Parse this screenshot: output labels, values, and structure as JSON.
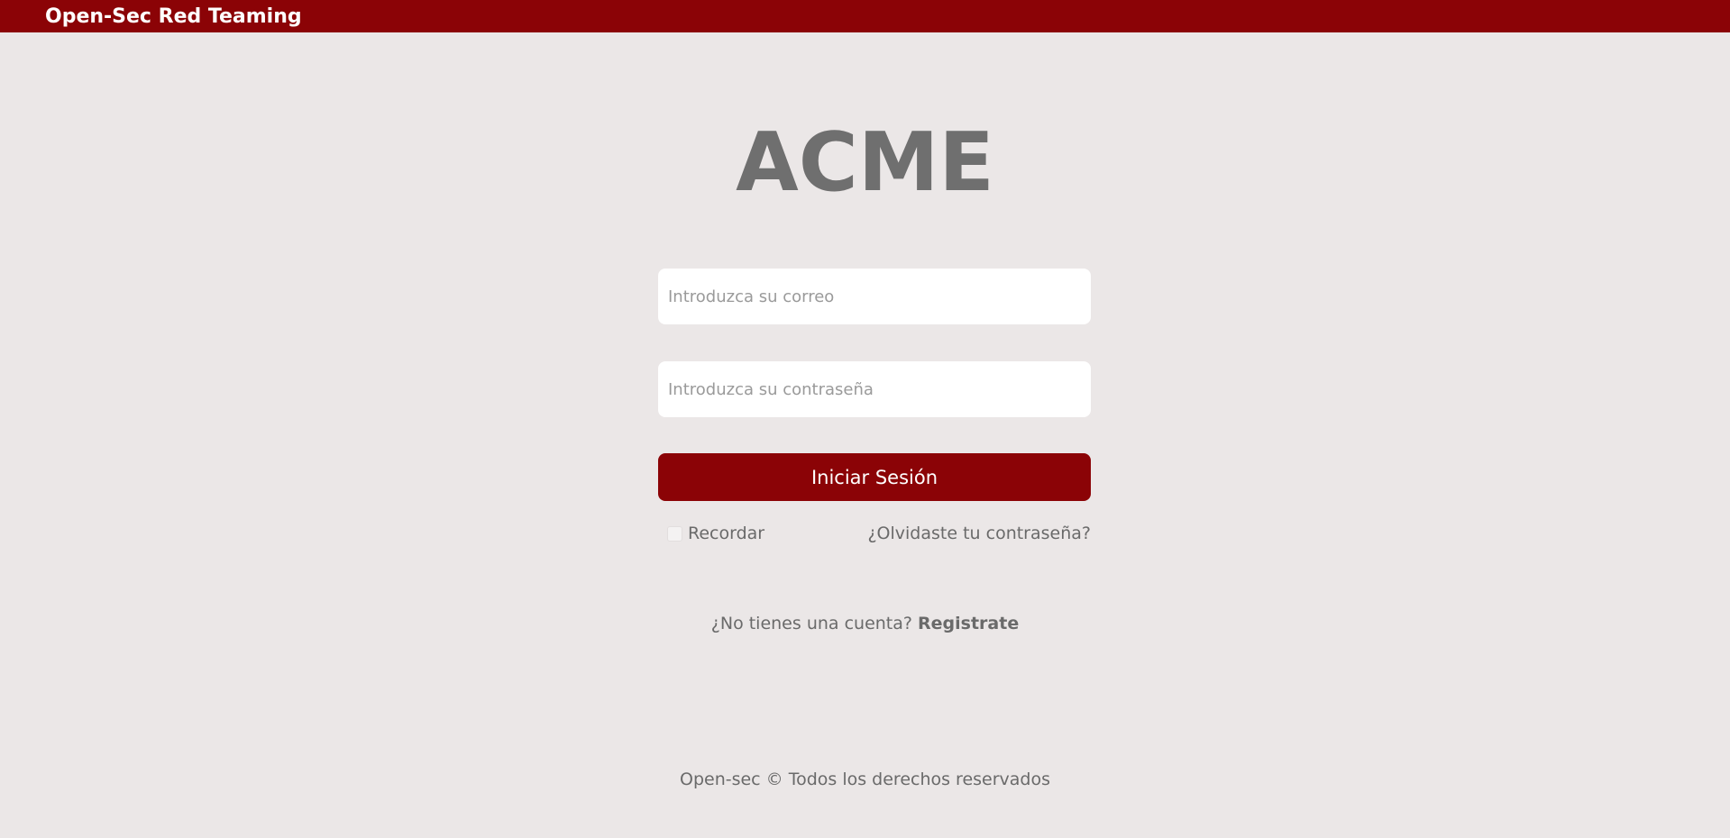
{
  "header": {
    "brand": "Open-Sec Red Teaming"
  },
  "login": {
    "logo": "ACME",
    "email_placeholder": "Introduzca su correo",
    "email_value": "",
    "password_placeholder": "Introduzca su contraseña",
    "password_value": "",
    "submit_label": "Iniciar Sesión",
    "remember_label": "Recordar",
    "remember_checked": false,
    "forgot_label": "¿Olvidaste tu contraseña?",
    "signup_prompt": "¿No tienes una cuenta?",
    "signup_link": "Registrate"
  },
  "footer": {
    "text": "Open-sec © Todos los derechos reservados"
  },
  "colors": {
    "accent": "#8b0306",
    "background": "#ebe7e7",
    "text": "#6a6a6a",
    "logo": "#6f6f6f"
  }
}
